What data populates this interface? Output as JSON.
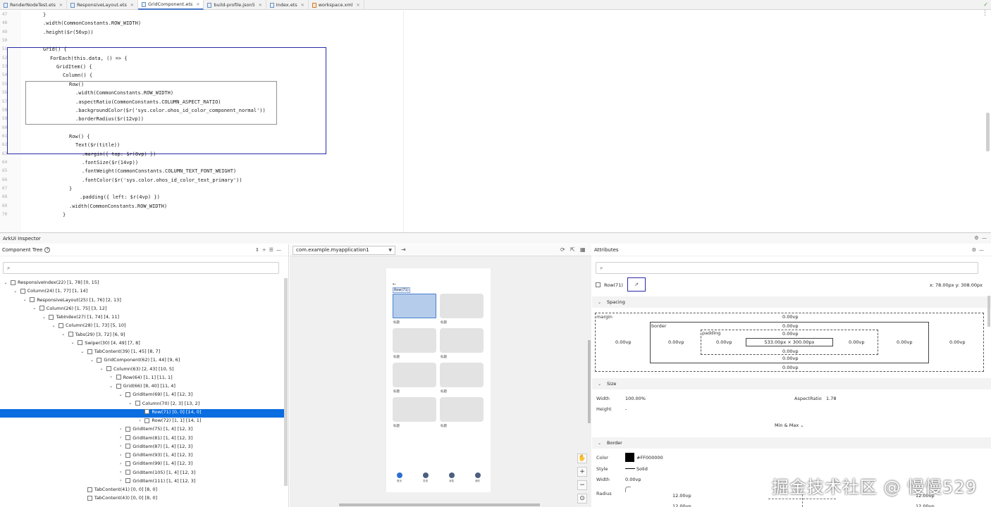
{
  "tabs": [
    {
      "label": "RenderNodeTest.ets",
      "active": false
    },
    {
      "label": "ResponsiveLayout.ets",
      "active": false
    },
    {
      "label": "GridComponent.ets",
      "active": true
    },
    {
      "label": "build-profile.json5",
      "active": false
    },
    {
      "label": "Index.ets",
      "active": false
    },
    {
      "label": "workspace.xml",
      "active": false
    }
  ],
  "editor": {
    "line_numbers": [
      "47",
      "48",
      "49",
      "50",
      "51",
      "52",
      "53",
      "54",
      "55",
      "56",
      "57",
      "58",
      "59",
      "60",
      "61",
      "62",
      "63",
      "64",
      "65",
      "66",
      "67",
      "68",
      "69",
      "70"
    ],
    "lines": [
      "}",
      ".width(CommonConstants.ROW_WIDTH)",
      ".height($r(56vp))",
      "",
      "Grid() {",
      "ForEach(this.data, () => {",
      "GridItem() {",
      "Column() {",
      "Row()",
      ".width(CommonConstants.ROW_WIDTH)",
      ".aspectRatio(CommonConstants.COLUMN_ASPECT_RATIO)",
      ".backgroundColor($r('sys.color.ohos_id_color_component_normal'))",
      ".borderRadius($r(12vp))",
      "",
      "Row() {",
      "Text($r(title))",
      ".margin({ top: $r(8vp) })",
      ".fontSize($r(14vp))",
      ".fontWeight(CommonConstants.COLUMN_TEXT_FONT_WEIGHT)",
      ".fontColor($r('sys.color.ohos_id_color_text_primary'))",
      "}",
      ".padding({ left: $r(4vp) })",
      ".width(CommonConstants.ROW_WIDTH)",
      "}"
    ]
  },
  "inspector": {
    "title": "ArkUI Inspector",
    "component_tree": {
      "title": "Component Tree",
      "nodes": [
        "ResponsiveIndex(22) [1, 78] [0, 15]",
        "Column(24) [1, 77] [1, 14]",
        "ResponsiveLayout(25) [1, 76] [2, 13]",
        "Column(26) [1, 75] [3, 12]",
        "TabIndex(27) [1, 74] [4, 11]",
        "Column(28) [1, 73] [5, 10]",
        "Tabs(29) [3, 72] [6, 9]",
        "Swiper(30) [4, 49] [7, 8]",
        "TabContent(39) [1, 45] [8, 7]",
        "GridComponent(62) [1, 44] [9, 6]",
        "Column(63) [2, 43] [10, 5]",
        "Row(64) [1, 1] [11, 1]",
        "Grid(66) [8, 40] [11, 4]",
        "GridItem(69) [1, 4] [12, 3]",
        "Column(70) [2, 3] [13, 2]",
        "Row(71) [0, 0] [14, 0]",
        "Row(72) [1, 1] [14, 1]",
        "GridItem(75) [1, 4] [12, 3]",
        "GridItem(81) [1, 4] [12, 3]",
        "GridItem(87) [1, 4] [12, 3]",
        "GridItem(93) [1, 4] [12, 3]",
        "GridItem(99) [1, 4] [12, 3]",
        "GridItem(105) [1, 4] [12, 3]",
        "GridItem(111) [1, 4] [12, 3]",
        "TabContent(41) [0, 0] [8, 0]",
        "TabContent(43) [0, 0] [8, 0]"
      ]
    },
    "device": "com.example.myapplication1",
    "preview": {
      "row_tag": "Row(71)",
      "cell_label": "标题",
      "nav_labels": [
        "首页",
        "发现",
        "消息",
        "我的"
      ]
    },
    "attributes": {
      "title": "Attributes",
      "node": "Row(71)",
      "coords": "x: 78.00px  y: 308.00px",
      "spacing_title": "Spacing",
      "margin_label": "margin",
      "border_label": "border",
      "padding_label": "padding",
      "zero": "0.00vp",
      "content_size": "533.00px × 300.00px",
      "size_title": "Size",
      "width_label": "Width",
      "width_value": "100.00%",
      "height_label": "Height",
      "height_value": "-",
      "aspect_label": "AspectRatio",
      "aspect_value": "1.78",
      "minmax": "Min & Max",
      "border_title": "Border",
      "color_label": "Color",
      "color_value": "#FF000000",
      "style_label": "Style",
      "style_value": "Solid",
      "bwidth_label": "Width",
      "bwidth_value": "0.00vp",
      "radius_label": "Radius",
      "radius_value": "12.00vp"
    }
  },
  "watermark": "掘金技术社区 @ 慢慢529",
  "colors": {
    "accent": "#0a6de0",
    "highlight_box": "#2a2aaa"
  }
}
